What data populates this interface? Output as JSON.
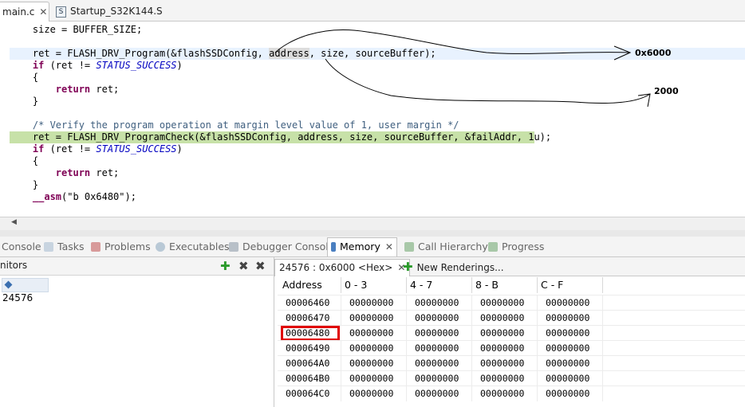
{
  "editor_tabs": [
    {
      "label": "main.c",
      "active": true
    },
    {
      "label": "Startup_S32K144.S",
      "active": false
    }
  ],
  "code_lines": [
    {
      "indent": "    ",
      "segments": [
        {
          "t": "size = BUFFER_SIZE;"
        }
      ]
    },
    {
      "indent": "",
      "segments": [
        {
          "t": ""
        }
      ]
    },
    {
      "indent": "    ",
      "highlight": "cursor",
      "segments": [
        {
          "t": "ret = FLASH_DRV_Program(&flashSSDConfig, "
        },
        {
          "t": "address",
          "c": "sel"
        },
        {
          "t": ", size, sourceBuffer);"
        }
      ]
    },
    {
      "indent": "    ",
      "segments": [
        {
          "t": "if",
          "c": "kw"
        },
        {
          "t": " (ret != "
        },
        {
          "t": "STATUS_SUCCESS",
          "c": "it"
        },
        {
          "t": ")"
        }
      ]
    },
    {
      "indent": "    ",
      "segments": [
        {
          "t": "{"
        }
      ]
    },
    {
      "indent": "        ",
      "segments": [
        {
          "t": "return",
          "c": "kw"
        },
        {
          "t": " ret;"
        }
      ]
    },
    {
      "indent": "    ",
      "segments": [
        {
          "t": "}"
        }
      ]
    },
    {
      "indent": "",
      "segments": [
        {
          "t": ""
        }
      ]
    },
    {
      "indent": "    ",
      "segments": [
        {
          "t": "/* Verify the program operation at margin level value of 1, user margin */",
          "c": "cm"
        }
      ]
    },
    {
      "indent": "    ",
      "highlight": "green",
      "segments": [
        {
          "t": "ret = FLASH_DRV_ProgramCheck(&flashSSDConfig, address, size, sourceBuffer, &failAddr, 1u);"
        }
      ]
    },
    {
      "indent": "    ",
      "segments": [
        {
          "t": "if",
          "c": "kw"
        },
        {
          "t": " (ret != "
        },
        {
          "t": "STATUS_SUCCESS",
          "c": "it"
        },
        {
          "t": ")"
        }
      ]
    },
    {
      "indent": "    ",
      "segments": [
        {
          "t": "{"
        }
      ]
    },
    {
      "indent": "        ",
      "segments": [
        {
          "t": "return",
          "c": "kw"
        },
        {
          "t": " ret;"
        }
      ]
    },
    {
      "indent": "    ",
      "segments": [
        {
          "t": "}"
        }
      ]
    },
    {
      "indent": "    ",
      "segments": [
        {
          "t": "__asm",
          "c": "kw"
        },
        {
          "t": "(\"b 0x6480\");"
        }
      ]
    }
  ],
  "annotations": {
    "address_value": "0x6000",
    "size_value": "2000"
  },
  "view_tabs": [
    {
      "label": "Console",
      "icon": "console-icon",
      "active": false
    },
    {
      "label": "Tasks",
      "icon": "tasks-icon",
      "active": false
    },
    {
      "label": "Problems",
      "icon": "problems-icon",
      "active": false
    },
    {
      "label": "Executables",
      "icon": "executables-icon",
      "active": false
    },
    {
      "label": "Debugger Console",
      "icon": "debugger-console-icon",
      "active": false
    },
    {
      "label": "Memory",
      "icon": "memory-icon",
      "active": true
    },
    {
      "label": "Call Hierarchy",
      "icon": "call-hierarchy-icon",
      "active": false
    },
    {
      "label": "Progress",
      "icon": "progress-icon",
      "active": false
    }
  ],
  "monitors": {
    "title": "nitors",
    "items": [
      "24576"
    ]
  },
  "rendering_tabs": {
    "active": "24576 : 0x6000 <Hex>",
    "new": "New Renderings..."
  },
  "memory": {
    "columns": [
      "Address",
      "0 - 3",
      "4 - 7",
      "8 - B",
      "C - F"
    ],
    "rows": [
      {
        "address": "00006460",
        "values": [
          "00000000",
          "00000000",
          "00000000",
          "00000000"
        ]
      },
      {
        "address": "00006470",
        "values": [
          "00000000",
          "00000000",
          "00000000",
          "00000000"
        ]
      },
      {
        "address": "00006480",
        "values": [
          "00000000",
          "00000000",
          "00000000",
          "00000000"
        ],
        "marked": true
      },
      {
        "address": "00006490",
        "values": [
          "00000000",
          "00000000",
          "00000000",
          "00000000"
        ]
      },
      {
        "address": "000064A0",
        "values": [
          "00000000",
          "00000000",
          "00000000",
          "00000000"
        ]
      },
      {
        "address": "000064B0",
        "values": [
          "00000000",
          "00000000",
          "00000000",
          "00000000"
        ]
      },
      {
        "address": "000064C0",
        "values": [
          "00000000",
          "00000000",
          "00000000",
          "00000000"
        ]
      }
    ]
  }
}
